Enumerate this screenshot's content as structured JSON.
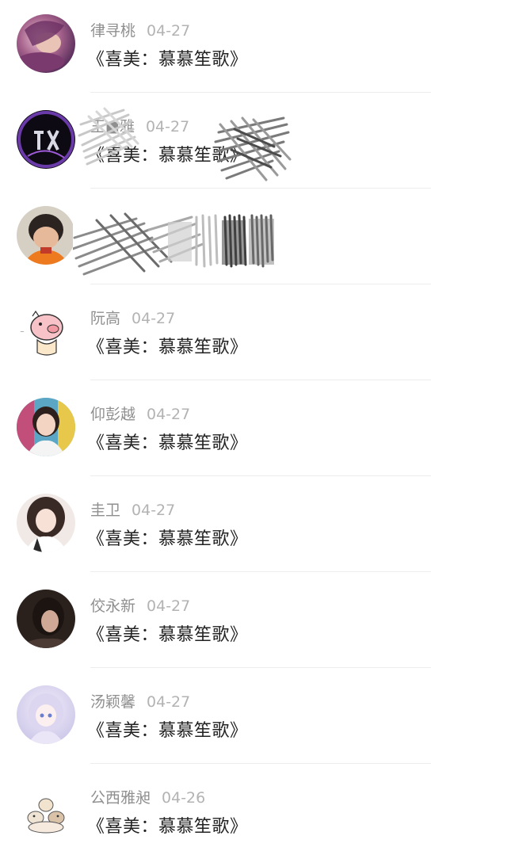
{
  "comments": [
    {
      "name": "律寻桃",
      "date": "04-27",
      "text": "《喜美：慕慕笙歌》",
      "avatar_icon": "purple-portrait-avatar",
      "redacted": false
    },
    {
      "name": "王■雅",
      "date": "04-27",
      "text": "《喜美：慕慕笙歌》",
      "avatar_icon": "dark-logo-avatar",
      "redacted": true
    },
    {
      "name": "",
      "date": "04-27",
      "text": "",
      "avatar_icon": "child-photo-avatar",
      "redacted": true
    },
    {
      "name": "阮高",
      "date": "04-27",
      "text": "《喜美：慕慕笙歌》",
      "avatar_icon": "cartoon-pig-avatar",
      "redacted": false
    },
    {
      "name": "仰彭越",
      "date": "04-27",
      "text": "《喜美：慕慕笙歌》",
      "avatar_icon": "girl-photo-avatar",
      "redacted": false
    },
    {
      "name": "圭卫",
      "date": "04-27",
      "text": "《喜美：慕慕笙歌》",
      "avatar_icon": "girl-selfie-avatar",
      "redacted": false
    },
    {
      "name": "佼永新",
      "date": "04-27",
      "text": "《喜美：慕慕笙歌》",
      "avatar_icon": "dark-portrait-avatar",
      "redacted": false
    },
    {
      "name": "汤颖馨",
      "date": "04-27",
      "text": "《喜美：慕慕笙歌》",
      "avatar_icon": "anime-girl-avatar",
      "redacted": false
    },
    {
      "name": "公西雅昶",
      "date": "04-26",
      "text": "《喜美：慕慕笙歌》",
      "avatar_icon": "cartoon-animals-avatar",
      "redacted": false
    }
  ],
  "colors": {
    "name": "#8f8f8f",
    "date": "#b3b3b3",
    "text": "#222222",
    "divider": "#ededed"
  }
}
